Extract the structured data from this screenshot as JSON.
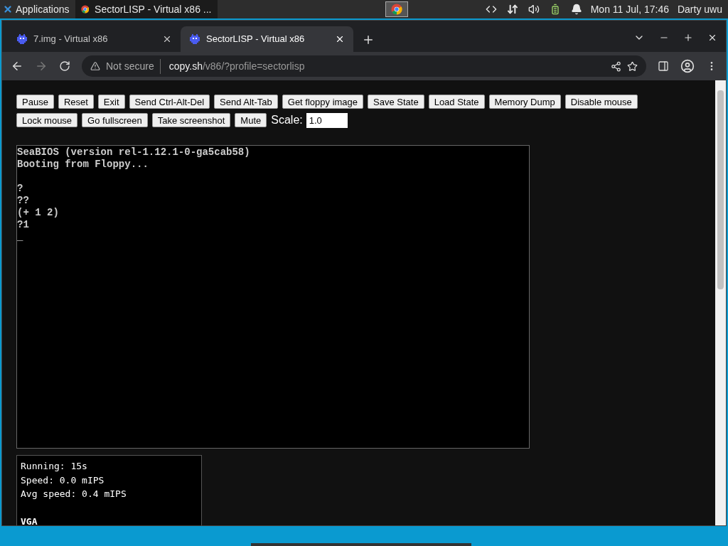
{
  "top_panel": {
    "applications": "Applications",
    "task": "SectorLISP - Virtual x86 ...",
    "clock": "Mon 11 Jul, 17:46",
    "user": "Darty uwu"
  },
  "browser": {
    "tabs": [
      {
        "title": "7.img - Virtual x86",
        "selected": false
      },
      {
        "title": "SectorLISP - Virtual x86",
        "selected": true
      }
    ],
    "address": {
      "security": "Not secure",
      "host": "copy.sh",
      "path": "/v86/?profile=sectorlisp"
    }
  },
  "controls": {
    "button_rows": [
      [
        "Pause",
        "Reset",
        "Exit",
        "Send Ctrl-Alt-Del",
        "Send Alt-Tab",
        "Get floppy image",
        "Save State",
        "Load State",
        "Memory Dump",
        "Disable mouse"
      ],
      [
        "Lock mouse",
        "Go fullscreen",
        "Take screenshot",
        "Mute"
      ]
    ],
    "scale": {
      "label": "Scale:",
      "value": "1.0"
    }
  },
  "screen": {
    "blocks": [
      [
        "SeaBIOS (version rel-1.12.1-0-ga5cab58)",
        "Booting from Floppy..."
      ],
      [
        "?",
        "??",
        "(+ 1 2)",
        "?1",
        "_"
      ]
    ]
  },
  "stats": [
    {
      "kind": "line",
      "text": "Running: 15s"
    },
    {
      "kind": "line",
      "text": "Speed: 0.0 mIPS"
    },
    {
      "kind": "line",
      "text": "Avg speed: 0.4 mIPS"
    },
    {
      "kind": "heading",
      "text": "VGA"
    }
  ]
}
